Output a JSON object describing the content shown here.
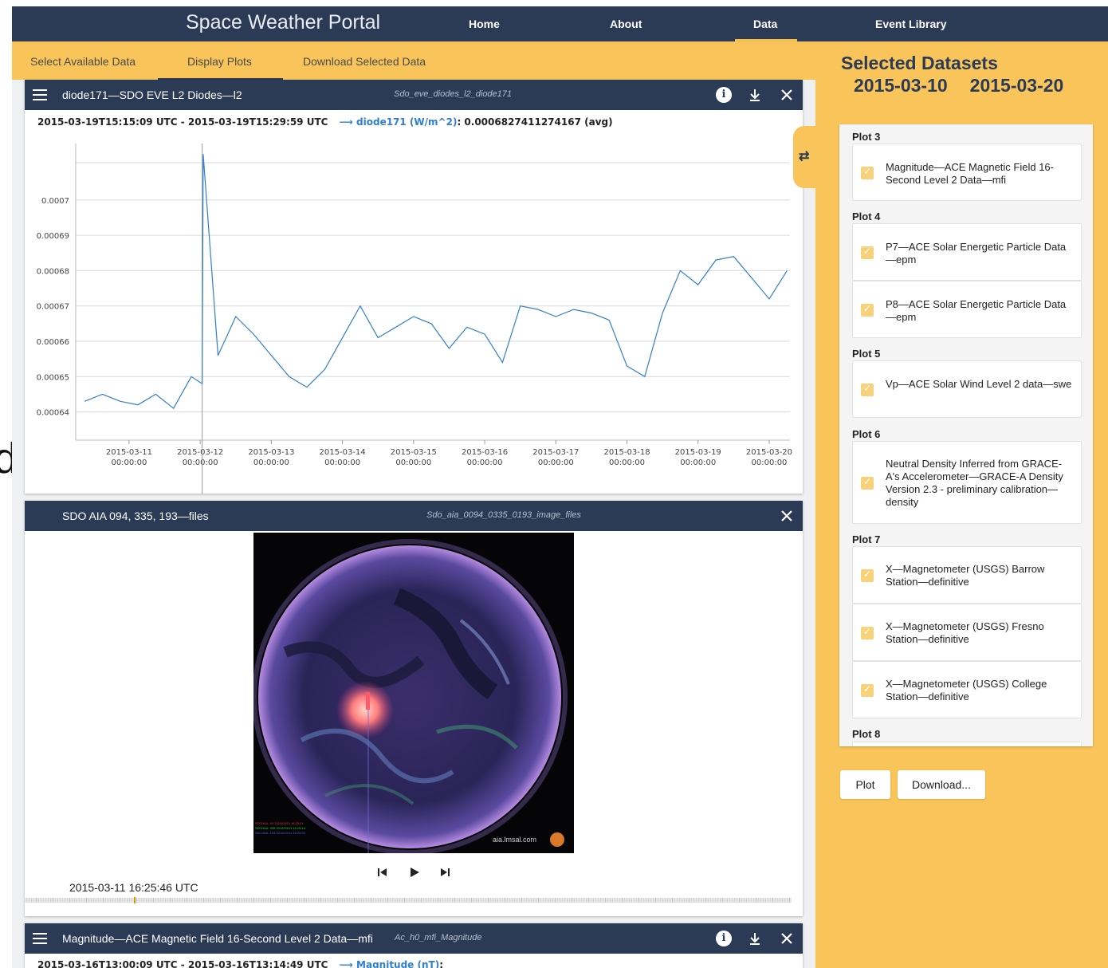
{
  "nav": {
    "brand": "Space Weather Portal",
    "links": [
      "Home",
      "About",
      "Data",
      "Event Library"
    ],
    "active": "Data"
  },
  "subnav": {
    "tabs": [
      "Select Available Data",
      "Display Plots",
      "Download Selected Data"
    ],
    "active": "Display Plots"
  },
  "panels": {
    "diode": {
      "title": "diode171—SDO EVE L2 Diodes—l2",
      "id": "Sdo_eve_diodes_l2_diode171",
      "range": "2015-03-19T15:15:09 UTC - 2015-03-19T15:29:59 UTC",
      "series_label": "diode171 (W/m^2)",
      "value": ": 0.0006827411274167 (avg)"
    },
    "aia": {
      "title": "SDO AIA 094, 335, 193—files",
      "id": "Sdo_aia_0094_0335_0193_image_files",
      "timestamp": "2015-03-11 16:25:46 UTC",
      "watermark": "aia.lmsal.com",
      "image_caption_lines": [
        "SDO/AIA- 94 2015/03/11 16:25:01",
        "SDO/AIA- 335 2015/03/11 16:25:14",
        "SDO/AIA- 193 2015/03/11 16:25:06"
      ]
    },
    "mag": {
      "title": "Magnitude—ACE Magnetic Field 16-Second Level 2 Data—mfi",
      "id": "Ac_h0_mfi_Magnitude",
      "range": "2015-03-16T13:00:09 UTC - 2015-03-16T13:14:49 UTC",
      "series_label": "Magnitude (nT)",
      "value": ":"
    }
  },
  "sidebar": {
    "title": "Selected Datasets",
    "start_date": "2015-03-10",
    "end_date": "2015-03-20",
    "groups": [
      {
        "label": "Plot 3",
        "items": [
          "Magnitude—ACE Magnetic Field 16-Second Level 2 Data—mfi"
        ]
      },
      {
        "label": "Plot 4",
        "items": [
          "P7—ACE Solar Energetic Particle Data—epm",
          "P8—ACE Solar Energetic Particle Data—epm"
        ]
      },
      {
        "label": "Plot 5",
        "items": [
          "Vp—ACE Solar Wind Level 2 data—swe"
        ]
      },
      {
        "label": "Plot 6",
        "items": [
          "Neutral Density Inferred from GRACE-A's Accelerometer—GRACE-A Density Version 2.3 - preliminary calibration—density"
        ]
      },
      {
        "label": "Plot 7",
        "items": [
          "X—Magnetometer (USGS) Barrow Station—definitive",
          "X—Magnetometer (USGS) Fresno Station—definitive",
          "X—Magnetometer (USGS) College Station—definitive"
        ]
      },
      {
        "label": "Plot 8",
        "items": []
      }
    ],
    "plot_button": "Plot",
    "download_button": "Download..."
  },
  "colors": {
    "navy": "#2b3a55",
    "gold": "#f9c55a",
    "series": "#2f7fcf"
  },
  "chart_data": {
    "type": "line",
    "title": "",
    "xlabel": "",
    "ylabel": "",
    "ylim": [
      0.000632,
      0.000716
    ],
    "yticks": [
      "0.00064",
      "0.00065",
      "0.00066",
      "0.00067",
      "0.00068",
      "0.00069",
      "0.0007"
    ],
    "xticks": [
      [
        "2015-03-11",
        "00:00:00"
      ],
      [
        "2015-03-12",
        "00:00:00"
      ],
      [
        "2015-03-13",
        "00:00:00"
      ],
      [
        "2015-03-14",
        "00:00:00"
      ],
      [
        "2015-03-15",
        "00:00:00"
      ],
      [
        "2015-03-16",
        "00:00:00"
      ],
      [
        "2015-03-17",
        "00:00:00"
      ],
      [
        "2015-03-18",
        "00:00:00"
      ],
      [
        "2015-03-19",
        "00:00:00"
      ],
      [
        "2015-03-20",
        "00:00:00"
      ]
    ],
    "grid": true,
    "series": [
      {
        "name": "diode171 (W/m^2)",
        "x": [
          "2015-03-10T09:00",
          "2015-03-10T15:00",
          "2015-03-10T21:00",
          "2015-03-11T03:00",
          "2015-03-11T09:00",
          "2015-03-11T15:00",
          "2015-03-11T21:00",
          "2015-03-12T00:40",
          "2015-03-12T01:00",
          "2015-03-12T06:00",
          "2015-03-12T12:00",
          "2015-03-12T18:00",
          "2015-03-13T00:00",
          "2015-03-13T06:00",
          "2015-03-13T12:00",
          "2015-03-13T18:00",
          "2015-03-14T00:00",
          "2015-03-14T06:00",
          "2015-03-14T12:00",
          "2015-03-14T18:00",
          "2015-03-15T00:00",
          "2015-03-15T06:00",
          "2015-03-15T12:00",
          "2015-03-15T18:00",
          "2015-03-16T00:00",
          "2015-03-16T06:00",
          "2015-03-16T12:00",
          "2015-03-16T18:00",
          "2015-03-17T00:00",
          "2015-03-17T06:00",
          "2015-03-17T12:00",
          "2015-03-17T18:00",
          "2015-03-18T00:00",
          "2015-03-18T06:00",
          "2015-03-18T12:00",
          "2015-03-18T18:00",
          "2015-03-19T00:00",
          "2015-03-19T06:00",
          "2015-03-19T12:00",
          "2015-03-19T18:00",
          "2015-03-20T00:00",
          "2015-03-20T06:00"
        ],
        "y": [
          0.000643,
          0.000645,
          0.000643,
          0.000642,
          0.000645,
          0.000641,
          0.00065,
          0.000648,
          0.000713,
          0.000656,
          0.000667,
          0.000662,
          0.000656,
          0.00065,
          0.000647,
          0.000652,
          0.000661,
          0.00067,
          0.000661,
          0.000664,
          0.000667,
          0.000665,
          0.000658,
          0.000664,
          0.000662,
          0.000654,
          0.00067,
          0.000669,
          0.000667,
          0.000669,
          0.000668,
          0.000666,
          0.000653,
          0.00065,
          0.000668,
          0.00068,
          0.000676,
          0.000683,
          0.000684,
          0.000678,
          0.000672,
          0.00068
        ]
      }
    ]
  }
}
